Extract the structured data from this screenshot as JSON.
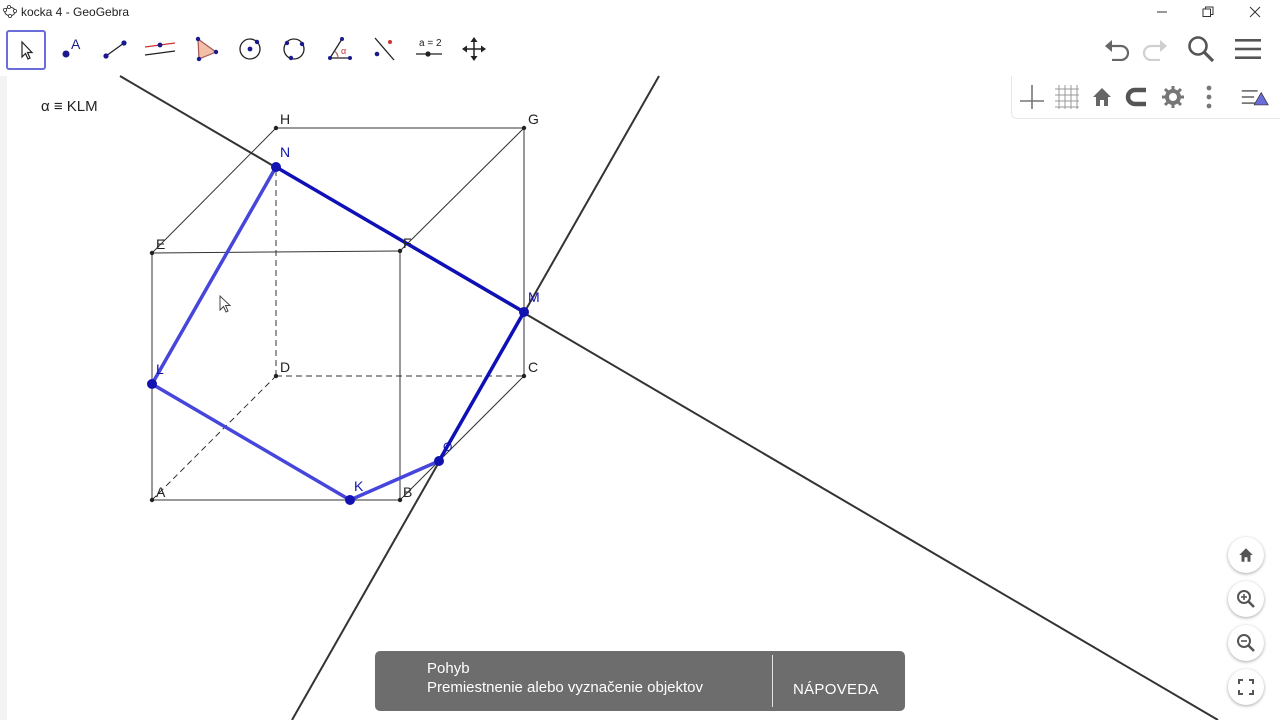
{
  "window": {
    "title": "kocka 4 - GeoGebra"
  },
  "toolbar": {
    "tools": [
      {
        "name": "move-tool",
        "icon": "arrow-cursor-icon"
      },
      {
        "name": "point-tool",
        "icon": "point-icon",
        "label": "A"
      },
      {
        "name": "segment-tool",
        "icon": "segment-icon"
      },
      {
        "name": "parallel-line-tool",
        "icon": "parallel-line-icon"
      },
      {
        "name": "polygon-tool",
        "icon": "polygon-icon"
      },
      {
        "name": "circle-tool",
        "icon": "circle-center-point-icon"
      },
      {
        "name": "conic-tool",
        "icon": "circle-three-points-icon"
      },
      {
        "name": "angle-tool",
        "icon": "angle-icon",
        "label": "α"
      },
      {
        "name": "reflect-tool",
        "icon": "reflect-line-icon"
      },
      {
        "name": "slider-tool",
        "icon": "slider-icon",
        "label": "a = 2"
      },
      {
        "name": "move-view-tool",
        "icon": "move-arrows-icon"
      }
    ]
  },
  "algebra": {
    "plane_label": "α ≡ KLM"
  },
  "points": {
    "A": "A",
    "B": "B",
    "C": "C",
    "D": "D",
    "E": "E",
    "F": "F",
    "G": "G",
    "H": "H",
    "K": "K",
    "L": "L",
    "M": "M",
    "N": "N",
    "O": "O"
  },
  "colors": {
    "section": "#1010b8",
    "section_light": "#4646dc",
    "edge": "#333333",
    "accent": "#6a6dd8",
    "snackbar": "#6d6d6d"
  },
  "snackbar": {
    "title": "Pohyb",
    "description": "Premiestnenie alebo vyznačenie objektov",
    "help_label": "NÁPOVEDA"
  }
}
